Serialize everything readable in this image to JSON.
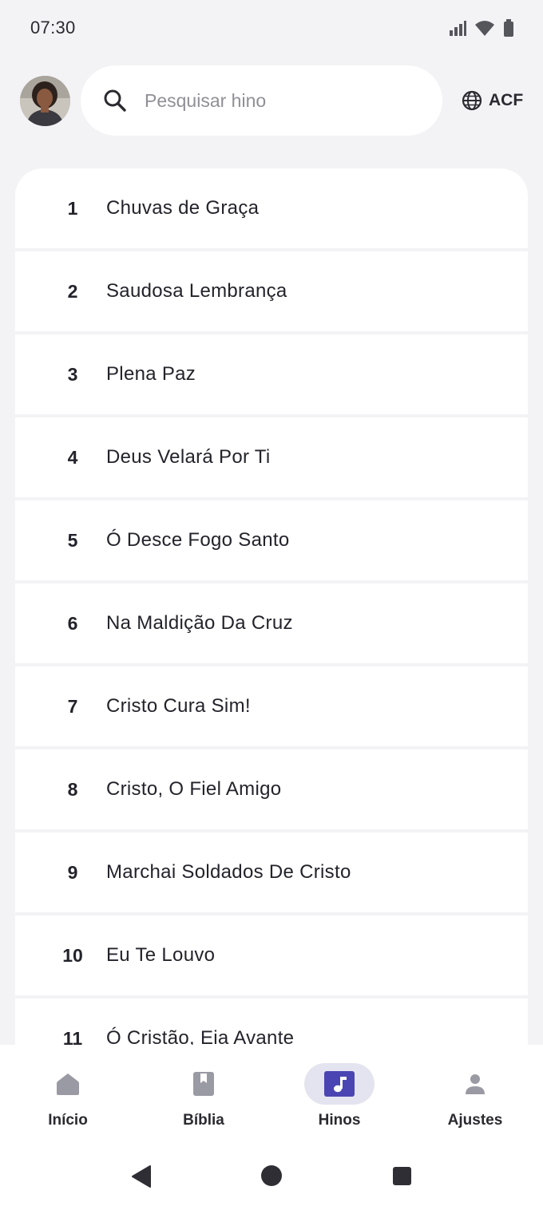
{
  "status": {
    "time": "07:30"
  },
  "search": {
    "placeholder": "Pesquisar hino"
  },
  "version": {
    "label": "ACF"
  },
  "hymns": [
    {
      "number": "1",
      "title": "Chuvas de Graça"
    },
    {
      "number": "2",
      "title": "Saudosa Lembrança"
    },
    {
      "number": "3",
      "title": "Plena Paz"
    },
    {
      "number": "4",
      "title": "Deus Velará Por Ti"
    },
    {
      "number": "5",
      "title": "Ó Desce Fogo Santo"
    },
    {
      "number": "6",
      "title": "Na Maldição Da Cruz"
    },
    {
      "number": "7",
      "title": "Cristo Cura Sim!"
    },
    {
      "number": "8",
      "title": "Cristo, O Fiel Amigo"
    },
    {
      "number": "9",
      "title": "Marchai Soldados De Cristo"
    },
    {
      "number": "10",
      "title": "Eu Te Louvo"
    },
    {
      "number": "11",
      "title": "Ó Cristão, Eia Avante"
    }
  ],
  "nav": {
    "items": [
      {
        "label": "Início",
        "icon": "home-icon"
      },
      {
        "label": "Bíblia",
        "icon": "book-icon"
      },
      {
        "label": "Hinos",
        "icon": "music-note-icon",
        "active": true
      },
      {
        "label": "Ajustes",
        "icon": "person-icon"
      }
    ]
  },
  "colors": {
    "accent": "#4b45b3",
    "background": "#f3f3f6",
    "inactive_icon": "#9a9aa4"
  }
}
